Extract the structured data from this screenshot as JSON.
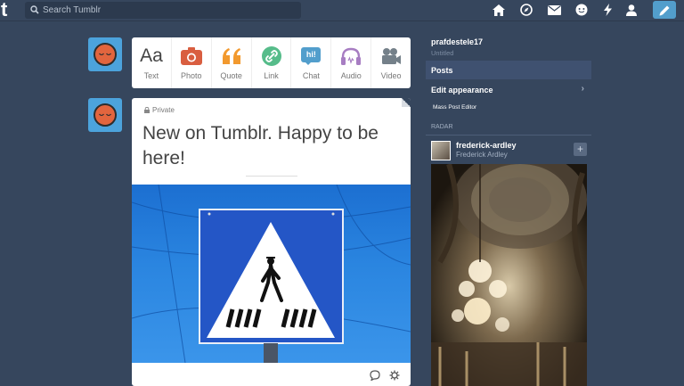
{
  "header": {
    "logo": "t",
    "search_placeholder": "Search Tumblr"
  },
  "icons": {
    "nav": [
      "home-icon",
      "explore-icon",
      "inbox-icon",
      "messaging-icon",
      "activity-icon",
      "account-icon"
    ],
    "compose": "pencil-icon"
  },
  "post_types": [
    {
      "label": "Text",
      "glyph": "Aa",
      "color": "#444444"
    },
    {
      "label": "Photo",
      "color": "#d95e40"
    },
    {
      "label": "Quote",
      "glyph": "“",
      "color": "#f2992e"
    },
    {
      "label": "Link",
      "color": "#56bc8a"
    },
    {
      "label": "Chat",
      "glyph": "hi!",
      "color": "#529ecc"
    },
    {
      "label": "Audio",
      "color": "#a77dc2"
    },
    {
      "label": "Video",
      "color": "#748089"
    }
  ],
  "post": {
    "privacy": "Private",
    "title": "New on Tumblr. Happy to be here!"
  },
  "sidebar": {
    "blog_name": "prafdestele17",
    "blog_title": "Untitled",
    "posts_label": "Posts",
    "edit_appearance_label": "Edit appearance",
    "mass_post_editor_label": "Mass Post Editor",
    "radar_label": "RADAR",
    "radar_user": "frederick-ardley",
    "radar_real_name": "Frederick Ardley",
    "follow_glyph": "+"
  },
  "colors": {
    "background": "#36465d",
    "accent": "#529ecc",
    "avatar_bg": "#4ca3dc",
    "avatar_face": "#e2653e"
  }
}
